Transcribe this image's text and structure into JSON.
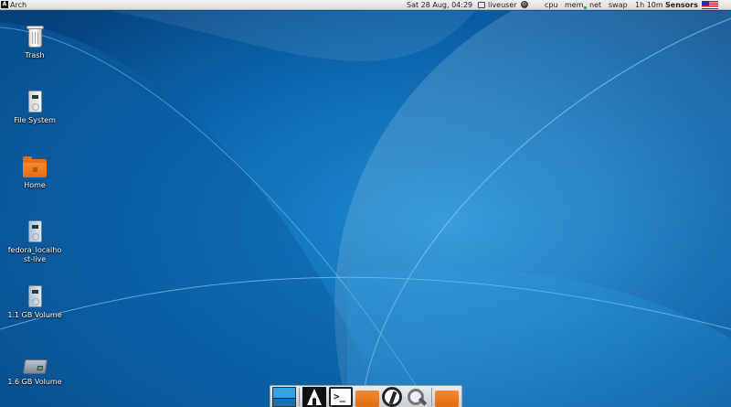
{
  "top_panel": {
    "apps_menu_label": "Arch",
    "clock": "Sat 28 Aug, 04:29",
    "user": "liveuser",
    "monitors": {
      "cpu": "cpu",
      "mem": "mem",
      "net": "net",
      "swap": "swap"
    },
    "uptime": "1h 10m",
    "sensors": "Sensors",
    "keyboard_layout_icon": "us-flag-icon"
  },
  "desktop": {
    "icons": [
      {
        "label": "Trash",
        "icon": "trash-icon"
      },
      {
        "label": "File System",
        "icon": "drive-icon"
      },
      {
        "label": "Home",
        "icon": "home-folder-icon"
      },
      {
        "label": "fedora_localhost-live",
        "icon": "drive-icon"
      },
      {
        "label": "1.1 GB Volume",
        "icon": "drive-icon"
      },
      {
        "label": "1.6 GB Volume",
        "icon": "hard-disk-icon"
      }
    ]
  },
  "dock": {
    "items": [
      {
        "icon": "show-desktop-icon"
      },
      {
        "icon": "arch-logo-icon"
      },
      {
        "icon": "terminal-icon",
        "glyph": ">_"
      },
      {
        "icon": "file-manager-icon"
      },
      {
        "icon": "web-browser-icon"
      },
      {
        "icon": "app-finder-icon"
      },
      {
        "icon": "folder-icon"
      }
    ]
  },
  "colors": {
    "wallpaper_base": "#0a5a9e",
    "folder_orange": "#e8701b",
    "panel_bg": "#e6e6e6"
  }
}
